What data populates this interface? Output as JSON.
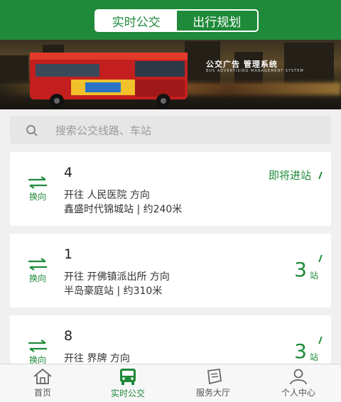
{
  "header": {
    "tabs": [
      {
        "label": "实时公交",
        "active": true
      },
      {
        "label": "出行规划",
        "active": false
      }
    ],
    "accent_color": "#1f8a3a"
  },
  "banner": {
    "title": "公交广告 管理系统",
    "subtitle": "BUS ADVERTISING MANAGEMENT SYSTEM"
  },
  "search": {
    "placeholder": "搜索公交线路、车站",
    "icon": "search-icon"
  },
  "buses": [
    {
      "route": "4",
      "swap_label": "换向",
      "direction": "开往 人民医院 方向",
      "stop_info": "鑫盛时代锦城站 | 约240米",
      "arrival_text": "即将进站",
      "arrival_num": "",
      "arrival_unit": ""
    },
    {
      "route": "1",
      "swap_label": "换向",
      "direction": "开往 开佛镇派出所 方向",
      "stop_info": "半岛豪庭站 | 约310米",
      "arrival_text": "",
      "arrival_num": "3",
      "arrival_unit": "站"
    },
    {
      "route": "8",
      "swap_label": "换向",
      "direction": "开往 界牌 方向",
      "stop_info": "",
      "arrival_text": "",
      "arrival_num": "3",
      "arrival_unit": "站"
    }
  ],
  "tabbar": [
    {
      "label": "首页",
      "icon": "home-icon",
      "active": false
    },
    {
      "label": "实时公交",
      "icon": "bus-icon",
      "active": true
    },
    {
      "label": "服务大厅",
      "icon": "ticket-icon",
      "active": false
    },
    {
      "label": "个人中心",
      "icon": "user-icon",
      "active": false
    }
  ]
}
